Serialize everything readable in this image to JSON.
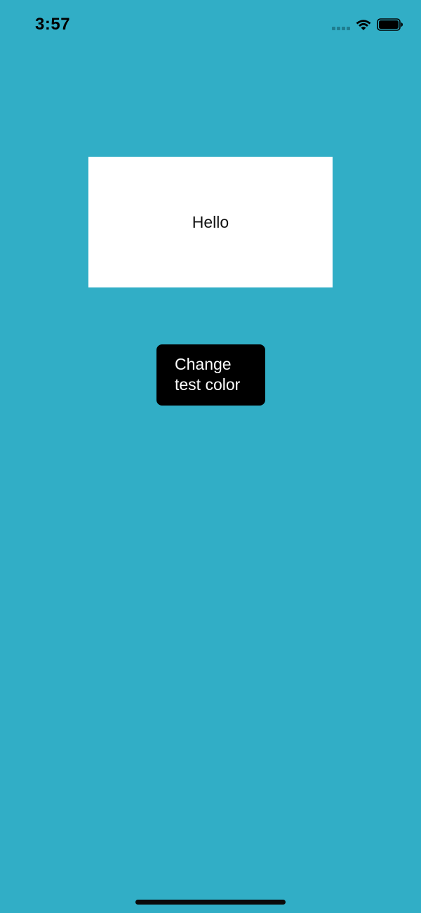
{
  "status_bar": {
    "time": "3:57"
  },
  "card": {
    "text": "Hello"
  },
  "button": {
    "label_line1": "Change",
    "label_line2": "test color"
  },
  "colors": {
    "background": "#31aec6",
    "card_background": "#ffffff",
    "button_background": "#000000",
    "button_text": "#ffffff"
  },
  "icons": [
    "signal-icon",
    "wifi-icon",
    "battery-icon"
  ]
}
